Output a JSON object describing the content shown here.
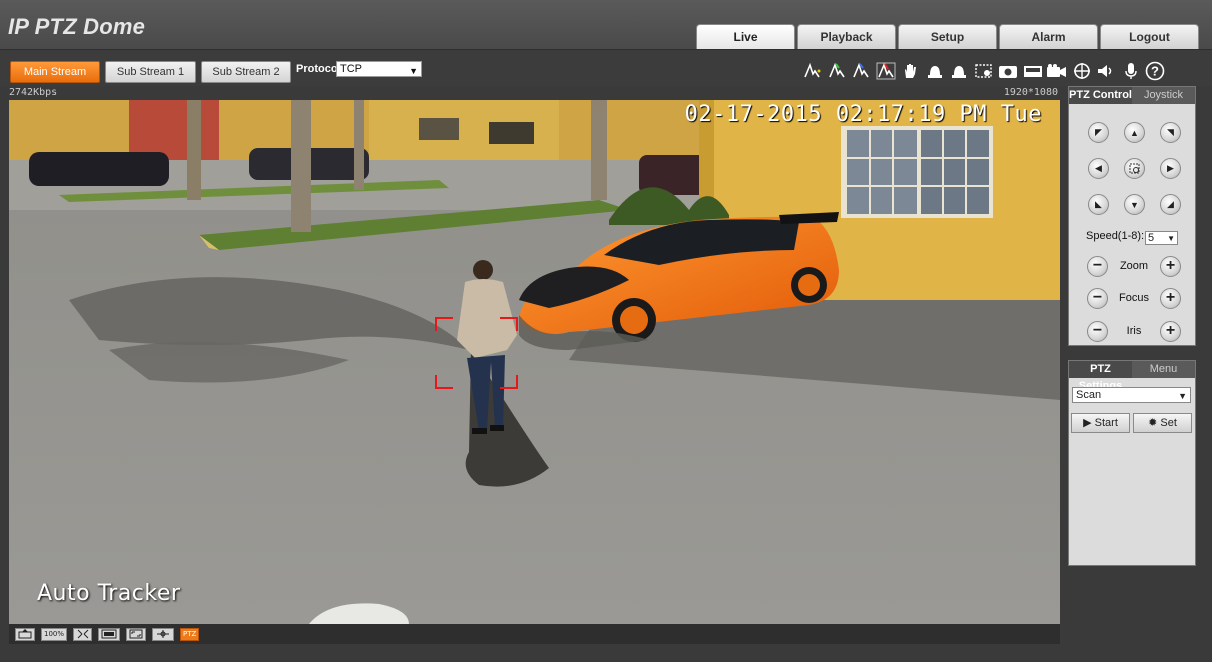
{
  "app": {
    "title": "IP PTZ Dome"
  },
  "nav": {
    "tabs": [
      "Live",
      "Playback",
      "Setup",
      "Alarm",
      "Logout"
    ]
  },
  "toolbar": {
    "streams": [
      "Main Stream",
      "Sub Stream 1",
      "Sub Stream 2"
    ],
    "protocol_label": "Protocol",
    "protocol_value": "TCP",
    "icons": [
      "draw-rule-icon",
      "draw-rule-2-icon",
      "draw-rule-3-icon",
      "draw-rule-red-icon",
      "hand-icon",
      "alarm-light-icon",
      "alarm-light-2-icon",
      "region-zoom-icon",
      "snapshot-icon",
      "record-icon",
      "video-camera-icon",
      "target-icon",
      "speaker-icon",
      "microphone-icon",
      "help-icon"
    ]
  },
  "video": {
    "bitrate": "2742Kbps",
    "resolution": "1920*1080",
    "osd_time": "02-17-2015 02:17:19 PM Tue",
    "osd_label": "Auto Tracker"
  },
  "bottom_bar": {
    "buttons": [
      "100%",
      "PTZ"
    ]
  },
  "ptz_control": {
    "tabs": [
      "PTZ Control",
      "Joystick"
    ],
    "speed_label": "Speed(1-8):",
    "speed_value": "5",
    "zoom_label": "Zoom",
    "focus_label": "Focus",
    "iris_label": "Iris"
  },
  "ptz_settings": {
    "tabs": [
      "PTZ Settings",
      "Menu"
    ],
    "mode_value": "Scan",
    "start_label": "Start",
    "set_label": "Set"
  },
  "colors": {
    "accent": "#ef7a1a",
    "track_box": "#e81818",
    "car": "#f07a16"
  }
}
